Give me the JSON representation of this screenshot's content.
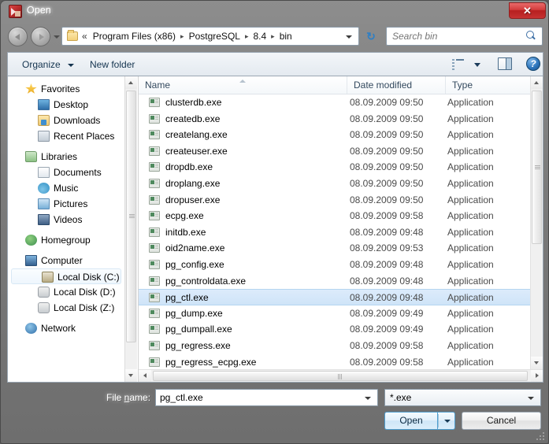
{
  "window": {
    "title": "Open",
    "app_icon": "app-icon",
    "close_label": "✕"
  },
  "address": {
    "back_icon": "back-arrow-icon",
    "forward_icon": "forward-arrow-icon",
    "history_icon": "chevron-down-icon",
    "folder_icon": "folder-icon",
    "overflow": "«",
    "crumbs": [
      "Program Files (x86)",
      "PostgreSQL",
      "8.4",
      "bin"
    ],
    "separator": "▸",
    "dropdown_icon": "chevron-down-icon",
    "refresh_icon": "refresh-icon",
    "refresh_glyph": "↻"
  },
  "search": {
    "placeholder": "Search bin",
    "value": "",
    "icon": "search-icon"
  },
  "toolbar": {
    "organize_label": "Organize",
    "new_folder_label": "New folder",
    "view_mode_icon": "view-list-icon",
    "view_mode_caret_icon": "chevron-down-icon",
    "preview_pane_icon": "preview-pane-icon",
    "help_label": "?",
    "help_icon": "help-icon"
  },
  "sidebar": {
    "groups": [
      {
        "root": {
          "label": "Favorites",
          "icon": "star-icon",
          "icon_class": "ico-star"
        },
        "children": [
          {
            "label": "Desktop",
            "icon": "desktop-icon",
            "icon_class": "ico-monitor"
          },
          {
            "label": "Downloads",
            "icon": "downloads-icon",
            "icon_class": "ico-download"
          },
          {
            "label": "Recent Places",
            "icon": "recent-places-icon",
            "icon_class": "ico-recent"
          }
        ]
      },
      {
        "root": {
          "label": "Libraries",
          "icon": "libraries-icon",
          "icon_class": "ico-library"
        },
        "children": [
          {
            "label": "Documents",
            "icon": "documents-icon",
            "icon_class": "ico-doc"
          },
          {
            "label": "Music",
            "icon": "music-icon",
            "icon_class": "ico-music"
          },
          {
            "label": "Pictures",
            "icon": "pictures-icon",
            "icon_class": "ico-picture"
          },
          {
            "label": "Videos",
            "icon": "videos-icon",
            "icon_class": "ico-video"
          }
        ]
      },
      {
        "root": {
          "label": "Homegroup",
          "icon": "homegroup-icon",
          "icon_class": "ico-homegroup"
        },
        "children": []
      },
      {
        "root": {
          "label": "Computer",
          "icon": "computer-icon",
          "icon_class": "ico-computer"
        },
        "children": [
          {
            "label": "Local Disk (C:)",
            "icon": "local-disk-c-icon",
            "icon_class": "ico-disk-c",
            "highlighted": true
          },
          {
            "label": "Local Disk (D:)",
            "icon": "local-disk-d-icon",
            "icon_class": "ico-disk"
          },
          {
            "label": "Local Disk (Z:)",
            "icon": "local-disk-z-icon",
            "icon_class": "ico-disk"
          }
        ]
      },
      {
        "root": {
          "label": "Network",
          "icon": "network-icon",
          "icon_class": "ico-network"
        },
        "children": []
      }
    ]
  },
  "file_list": {
    "columns": [
      "Name",
      "Date modified",
      "Type"
    ],
    "sort_column": "Name",
    "sort_direction": "ascending",
    "sort_icon": "sort-ascending-icon",
    "rows": [
      {
        "name": "clusterdb.exe",
        "date": "08.09.2009 09:50",
        "type": "Application",
        "selected": false
      },
      {
        "name": "createdb.exe",
        "date": "08.09.2009 09:50",
        "type": "Application",
        "selected": false
      },
      {
        "name": "createlang.exe",
        "date": "08.09.2009 09:50",
        "type": "Application",
        "selected": false
      },
      {
        "name": "createuser.exe",
        "date": "08.09.2009 09:50",
        "type": "Application",
        "selected": false
      },
      {
        "name": "dropdb.exe",
        "date": "08.09.2009 09:50",
        "type": "Application",
        "selected": false
      },
      {
        "name": "droplang.exe",
        "date": "08.09.2009 09:50",
        "type": "Application",
        "selected": false
      },
      {
        "name": "dropuser.exe",
        "date": "08.09.2009 09:50",
        "type": "Application",
        "selected": false
      },
      {
        "name": "ecpg.exe",
        "date": "08.09.2009 09:58",
        "type": "Application",
        "selected": false
      },
      {
        "name": "initdb.exe",
        "date": "08.09.2009 09:48",
        "type": "Application",
        "selected": false
      },
      {
        "name": "oid2name.exe",
        "date": "08.09.2009 09:53",
        "type": "Application",
        "selected": false
      },
      {
        "name": "pg_config.exe",
        "date": "08.09.2009 09:48",
        "type": "Application",
        "selected": false
      },
      {
        "name": "pg_controldata.exe",
        "date": "08.09.2009 09:48",
        "type": "Application",
        "selected": false
      },
      {
        "name": "pg_ctl.exe",
        "date": "08.09.2009 09:48",
        "type": "Application",
        "selected": true
      },
      {
        "name": "pg_dump.exe",
        "date": "08.09.2009 09:49",
        "type": "Application",
        "selected": false
      },
      {
        "name": "pg_dumpall.exe",
        "date": "08.09.2009 09:49",
        "type": "Application",
        "selected": false
      },
      {
        "name": "pg_regress.exe",
        "date": "08.09.2009 09:58",
        "type": "Application",
        "selected": false
      },
      {
        "name": "pg_regress_ecpg.exe",
        "date": "08.09.2009 09:58",
        "type": "Application",
        "selected": false
      }
    ]
  },
  "footer": {
    "filename_label_pre": "File ",
    "filename_label_underline": "n",
    "filename_label_post": "ame:",
    "filename_value": "pg_ctl.exe",
    "filename_dropdown_icon": "chevron-down-icon",
    "filter_value": "*.exe",
    "filter_dropdown_icon": "chevron-down-icon",
    "open_label": "Open",
    "open_dropdown_icon": "chevron-down-icon",
    "cancel_label": "Cancel"
  }
}
